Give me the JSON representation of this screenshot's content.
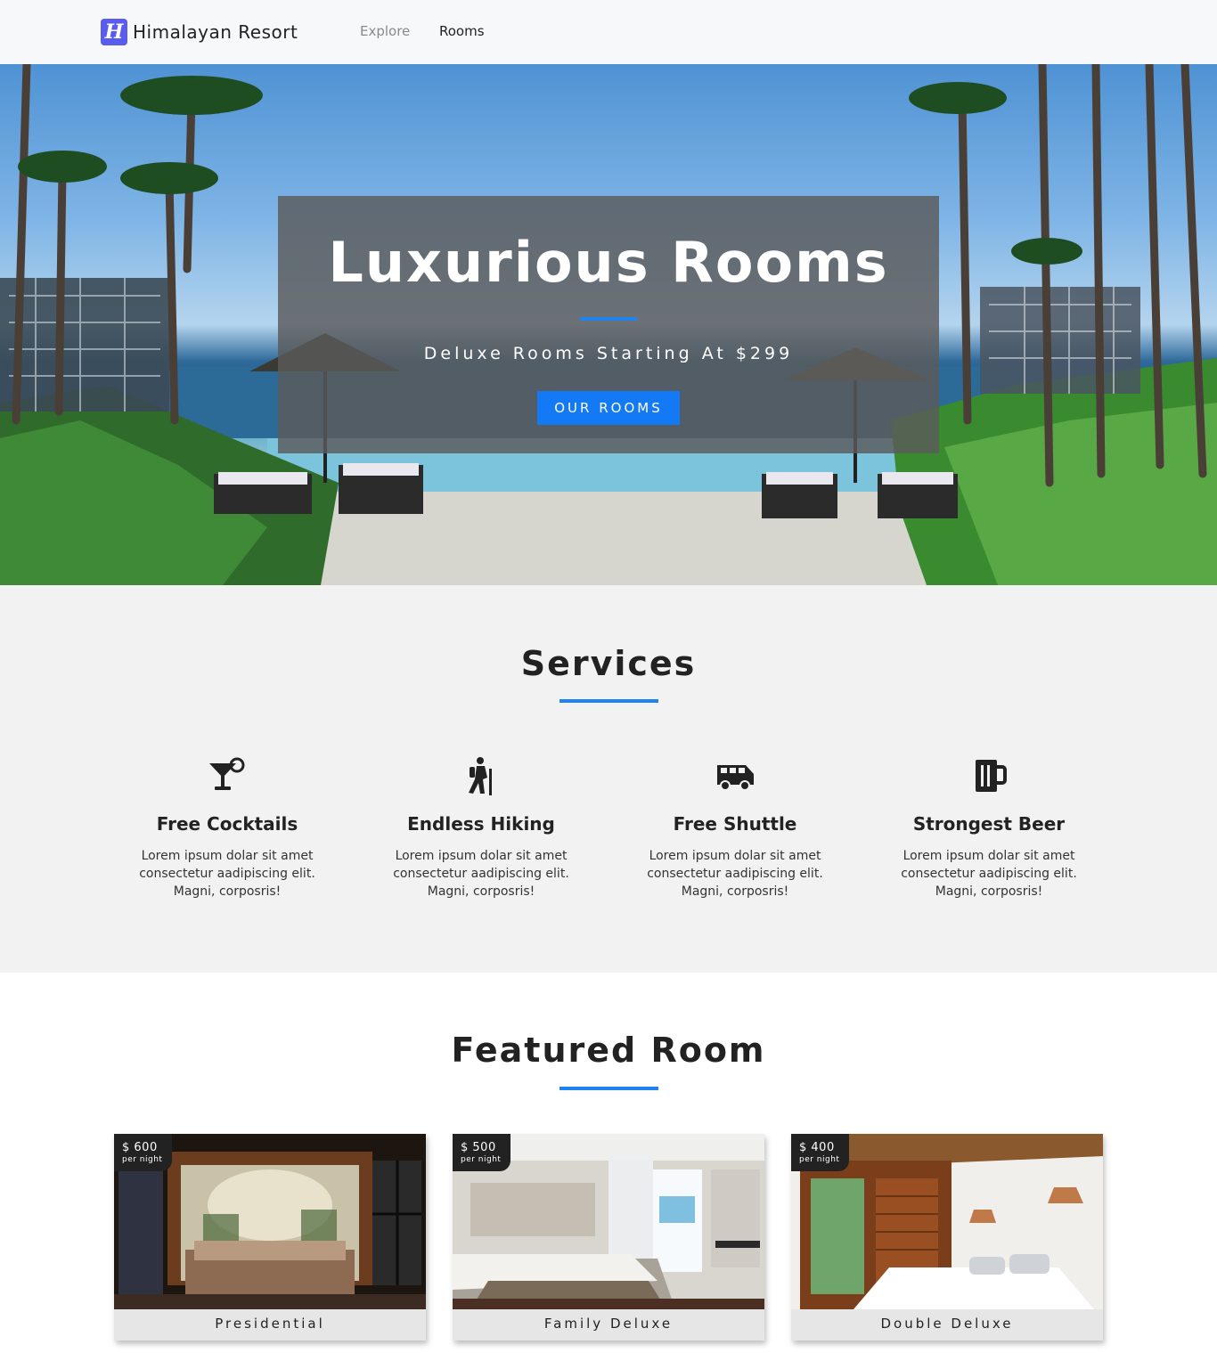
{
  "navbar": {
    "logo_letter": "H",
    "brand_name": "Himalayan Resort",
    "links": [
      "Explore",
      "Rooms"
    ]
  },
  "hero": {
    "title": "Luxurious Rooms",
    "subtitle": "Deluxe Rooms Starting At $299",
    "button_label": "OUR ROOMS"
  },
  "services": {
    "title": "Services",
    "items": [
      {
        "icon": "cocktail-icon",
        "title": "Free Cocktails",
        "desc": "Lorem ipsum dolar sit amet consectetur aadipiscing elit. Magni, corposris!"
      },
      {
        "icon": "hiking-icon",
        "title": "Endless Hiking",
        "desc": "Lorem ipsum dolar sit amet consectetur aadipiscing elit. Magni, corposris!"
      },
      {
        "icon": "shuttle-icon",
        "title": "Free Shuttle",
        "desc": "Lorem ipsum dolar sit amet consectetur aadipiscing elit. Magni, corposris!"
      },
      {
        "icon": "beer-icon",
        "title": "Strongest Beer",
        "desc": "Lorem ipsum dolar sit amet consectetur aadipiscing elit. Magni, corposris!"
      }
    ]
  },
  "featured": {
    "title": "Featured Room",
    "rooms": [
      {
        "price": "$ 600",
        "unit": "per night",
        "name": "Presidential"
      },
      {
        "price": "$ 500",
        "unit": "per night",
        "name": "Family Deluxe"
      },
      {
        "price": "$ 400",
        "unit": "per night",
        "name": "Double Deluxe"
      }
    ]
  },
  "colors": {
    "accent": "#1e82f0",
    "button": "#1479f5",
    "logo": "#5a5cf0",
    "navbar_bg": "#f7f8f9",
    "services_bg": "#f2f2f2"
  }
}
